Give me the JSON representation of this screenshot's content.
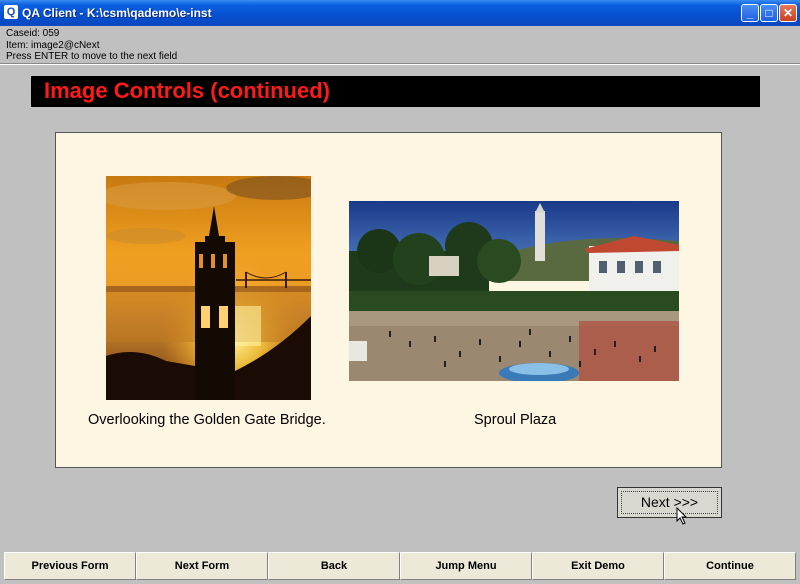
{
  "window": {
    "title": "QA Client - K:\\csm\\qademo\\e-inst",
    "app_icon_glyph": "Q",
    "minimize_glyph": "_",
    "maximize_glyph": "□",
    "close_glyph": "✕"
  },
  "info": {
    "caseid": "Caseid: 059",
    "item": "Item: image2@cNext",
    "hint": "Press ENTER to move to the next field"
  },
  "banner": {
    "title": "Image Controls (continued)",
    "color": "#ff1a1a"
  },
  "images": [
    {
      "caption": "Overlooking the Golden Gate Bridge."
    },
    {
      "caption": "Sproul Plaza"
    }
  ],
  "next_button": {
    "label": "Next >>>"
  },
  "bottom_bar": {
    "buttons": [
      "Previous Form",
      "Next Form",
      "Back",
      "Jump Menu",
      "Exit Demo",
      "Continue"
    ]
  }
}
